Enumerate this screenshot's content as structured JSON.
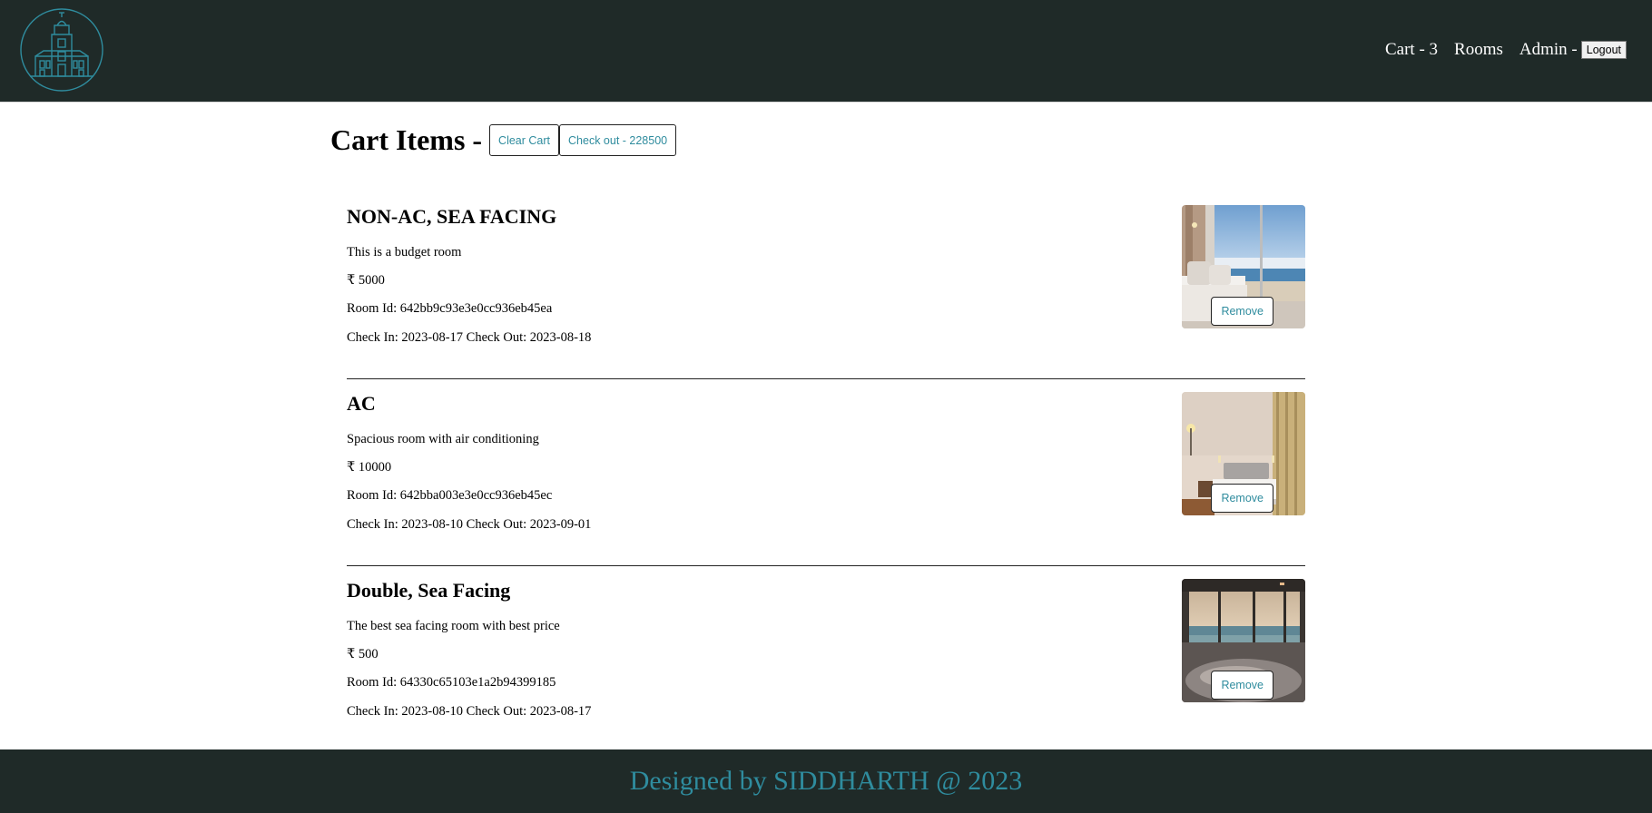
{
  "nav": {
    "cart_label": "Cart - 3",
    "rooms_label": "Rooms",
    "admin_label": "Admin -",
    "logout_label": "Logout"
  },
  "cart": {
    "title": "Cart Items -",
    "clear_label": "Clear Cart",
    "checkout_label": "Check out - 228500",
    "remove_label": "Remove",
    "items": [
      {
        "title": "NON-AC, SEA FACING",
        "description": "This is a budget room",
        "price": "₹ 5000",
        "room_id": "Room Id: 642bb9c93e3e0cc936eb45ea",
        "dates": "Check In: 2023-08-17 Check Out: 2023-08-18"
      },
      {
        "title": "AC",
        "description": "Spacious room with air conditioning",
        "price": "₹ 10000",
        "room_id": "Room Id: 642bba003e3e0cc936eb45ec",
        "dates": "Check In: 2023-08-10 Check Out: 2023-09-01"
      },
      {
        "title": "Double, Sea Facing",
        "description": "The best sea facing room with best price",
        "price": "₹ 500",
        "room_id": "Room Id: 64330c65103e1a2b94399185",
        "dates": "Check In: 2023-08-10 Check Out: 2023-08-17"
      }
    ]
  },
  "footer": {
    "text": "Designed by SIDDHARTH @ 2023"
  },
  "colors": {
    "header_bg": "#1f2a28",
    "accent": "#2f8c9e"
  },
  "icons": {
    "logo": "hotel-building-logo-icon"
  }
}
